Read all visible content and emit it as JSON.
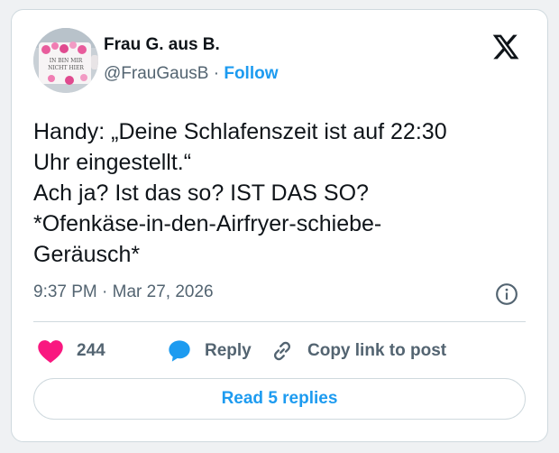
{
  "author": {
    "name": "Frau G. aus B.",
    "handle": "@FrauGausB",
    "separator": "·",
    "follow_label": "Follow",
    "avatar_mug_text_1": "IN BIN MIR",
    "avatar_mug_text_2": "NICHT HIER"
  },
  "tweet": {
    "lines": [
      "Handy: „Deine Schlafenszeit ist auf 22:30",
      "Uhr eingestellt.“",
      "Ach ja? Ist das so? IST DAS SO?",
      "*Ofenkäse-in-den-Airfryer-schiebe-",
      "Geräusch*"
    ]
  },
  "meta": {
    "time": "9:37 PM",
    "separator": "·",
    "date": "Mar 27, 2026"
  },
  "actions": {
    "like_count": "244",
    "reply_label": "Reply",
    "copy_label": "Copy link to post"
  },
  "read_replies_label": "Read 5 replies",
  "icons": {
    "brand": "x-logo-icon",
    "info": "info-icon",
    "like": "heart-icon",
    "reply": "speech-bubble-icon",
    "copy": "link-icon"
  },
  "colors": {
    "accent": "#1d9bf0",
    "like": "#f91880",
    "text": "#0f1419",
    "muted": "#536471",
    "border": "#cfd9de"
  }
}
